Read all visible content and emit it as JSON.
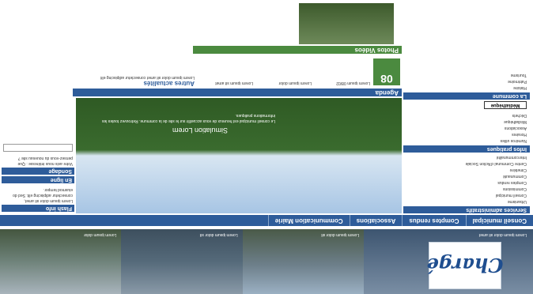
{
  "banner": {
    "logo_text": "Chargé",
    "logo_caption": "Lorem ipsum dolor sit amet",
    "captions": [
      "Lorem ipsum dolor sit",
      "Lorem ipsum dolor sit",
      "Lorem ipsum dolor"
    ]
  },
  "nav": [
    "Conseil municipal",
    "Comptes rendus",
    "Associations",
    "Communication Mairie"
  ],
  "sidebar": {
    "head1": "Services administratifs",
    "list1": [
      "Urbanisme",
      "Conseil municipal",
      "Commissions",
      "Comptes rendus",
      "Communauté",
      "Cimetière",
      "Centre Communal d'Action Sociale",
      "Intercommunalité"
    ],
    "head2": "Infos pratiques",
    "list2": [
      "Numéros utiles",
      "Horaires",
      "Associations",
      "Médiathèque",
      "Déchets"
    ],
    "mediatheque": "Médiathèque",
    "head3": "La commune",
    "list3": [
      "Histoire",
      "Patrimoine",
      "Tourisme"
    ]
  },
  "hero": {
    "title": "Simulation Lorem",
    "text": "Le conseil municipal est heureux de vous accueillir sur le site de la commune. Retrouvez toutes les informations pratiques."
  },
  "agenda": {
    "head": "Agenda",
    "cal_day": "08",
    "items": [
      "Lorem ipsum 08/02",
      "Lorem ipsum dolor",
      "Lorem ipsum sit amet"
    ]
  },
  "autres": {
    "title": "Autres actualités",
    "text": "Lorem ipsum dolor sit amet consectetur adipiscing elit"
  },
  "photos": {
    "head": "Photos Vidéos"
  },
  "flash": {
    "head": "Flash info",
    "text": "Lorem ipsum dolor sit amet, consectetur adipiscing elit. Sed do eiusmod tempor.",
    "enligne": "En ligne"
  },
  "sondage": {
    "head": "Sondage",
    "text": "Votre avis nous intéresse : Que pensez-vous du nouveau site ?"
  }
}
